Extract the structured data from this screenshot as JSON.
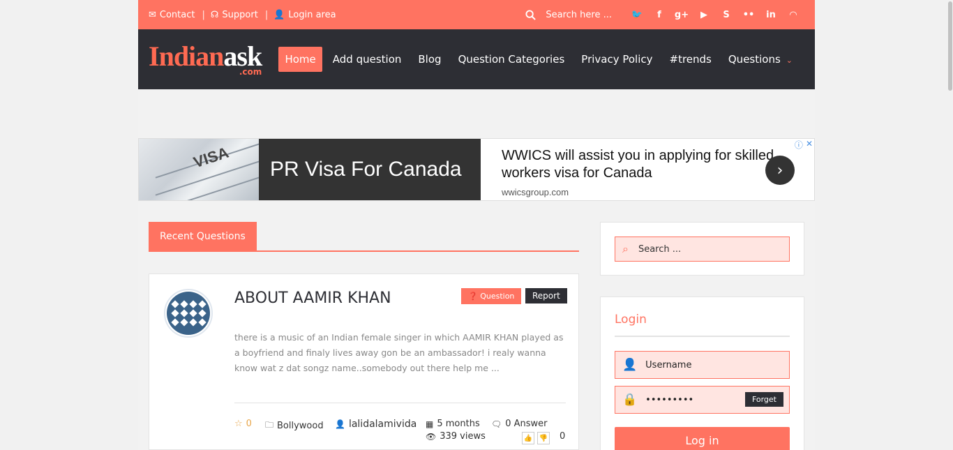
{
  "topbar": {
    "contact": "Contact",
    "support": "Support",
    "login_area": "Login area",
    "search_placeholder": "Search here ...",
    "social": [
      "twitter-icon",
      "facebook-icon",
      "google-plus-icon",
      "youtube-icon",
      "skype-icon",
      "flickr-icon",
      "linkedin-icon",
      "rss-icon"
    ]
  },
  "logo": {
    "part1": "Indian",
    "part2": "ask",
    "tld": ".com"
  },
  "nav": {
    "items": [
      "Home",
      "Add question",
      "Blog",
      "Question Categories",
      "Privacy Policy",
      "#trends",
      "Questions"
    ],
    "active": "Home"
  },
  "ad": {
    "stamp": "VISA",
    "headline": "PR Visa For Canada",
    "copy": "WWICS will assist you in applying for skilled workers visa for Canada",
    "domain": "wwicsgroup.com"
  },
  "section": {
    "title": "Recent Questions"
  },
  "question": {
    "title": "ABOUT AAMIR KHAN",
    "type_badge": "Question",
    "report": "Report",
    "excerpt": "there is a music of an Indian female singer in which AAMIR KHAN played as a boyfriend and finaly lives away gon be an ambassador! i realy wanna know wat z dat songz name..somebody out there help me ...",
    "rating": "0",
    "category": "Bollywood",
    "author": "lalidalamivida",
    "time": "5 months",
    "answers": "0 Answer",
    "views": "339 views",
    "votes": "0"
  },
  "sidebar": {
    "search_placeholder": "Search ...",
    "login_title": "Login",
    "username_placeholder": "Username",
    "password_mask": "•••••••••",
    "forget": "Forget",
    "login_button": "Log in"
  },
  "colors": {
    "accent": "#ff7361",
    "dark": "#2d2e34"
  }
}
